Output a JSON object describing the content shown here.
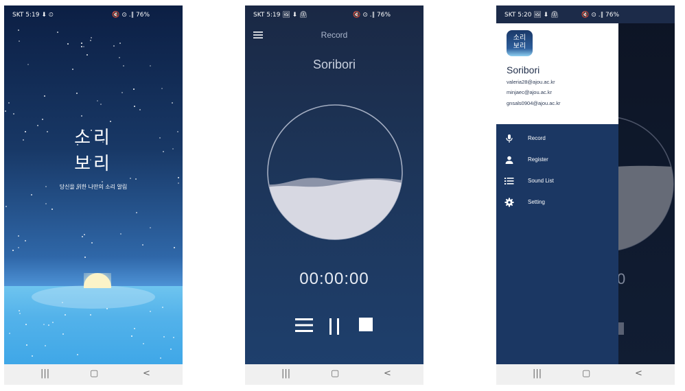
{
  "phones": [
    {
      "status": {
        "left": "SKT 5:19 ⬇ ⏲",
        "right": "🔇 ⊙ .∥ 76%"
      },
      "splash": {
        "title_line1": "소리",
        "title_line2": "보리",
        "subtitle": "당신을 위한 나만의 소리 알림"
      }
    },
    {
      "status": {
        "left": "SKT 5:19 🖼 ⬇ ⏲",
        "right": "🔇 ⊙ .∥ 76%"
      },
      "toolbar_title": "Record",
      "app_name": "Soribori",
      "timer": "00:00:00",
      "wave_level": 0.6
    },
    {
      "status": {
        "left": "SKT 5:20 🖼 ⬇ ⏲",
        "right": "🔇 ⊙ .∥ 76%"
      },
      "drawer": {
        "icon_line1": "소리",
        "icon_line2": "보리",
        "name": "Soribori",
        "emails": [
          "valeria28@ajou.ac.kr",
          "minjaec@ajou.ac.kr",
          "gnsals0904@ajou.ac.kr"
        ],
        "menu": [
          {
            "label": "Record",
            "icon": "mic-icon"
          },
          {
            "label": "Register",
            "icon": "person-icon"
          },
          {
            "label": "Sound List",
            "icon": "list-icon"
          },
          {
            "label": "Setting",
            "icon": "gear-icon"
          }
        ]
      },
      "bg_timer_fragment": "0"
    }
  ],
  "navbar": {
    "recent": "|||",
    "home": "▢",
    "back": "<"
  }
}
